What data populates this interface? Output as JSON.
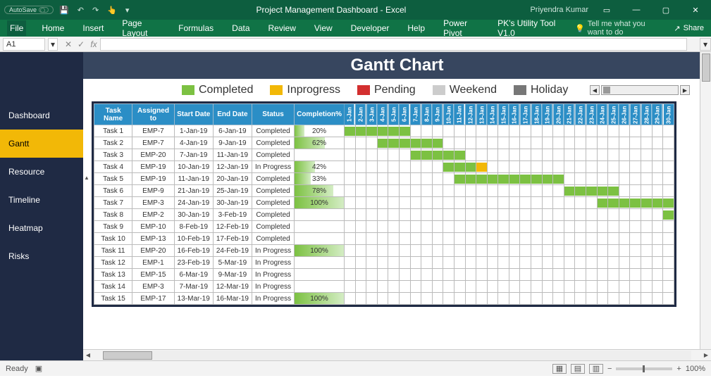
{
  "titlebar": {
    "autosave": "AutoSave",
    "doc_title": "Project Management Dashboard  -  Excel",
    "user": "Priyendra Kumar"
  },
  "qat": {
    "save": "save",
    "undo": "undo",
    "redo": "redo",
    "touch": "touch",
    "more": "more"
  },
  "ribbon": {
    "tabs": [
      "File",
      "Home",
      "Insert",
      "Page Layout",
      "Formulas",
      "Data",
      "Review",
      "View",
      "Developer",
      "Help",
      "Power Pivot",
      "PK's Utility Tool V1.0"
    ],
    "tell": "Tell me what you want to do",
    "share": "Share"
  },
  "formula": {
    "name": "A1",
    "fx": "fx"
  },
  "sidebar": {
    "items": [
      "Dashboard",
      "Gantt",
      "Resource",
      "Timeline",
      "Heatmap",
      "Risks"
    ],
    "active": 1
  },
  "banner": "Gantt Chart",
  "legend": {
    "completed": "Completed",
    "inprogress": "Inprogress",
    "pending": "Pending",
    "weekend": "Weekend",
    "holiday": "Holiday"
  },
  "headers": {
    "task": "Task Name",
    "assigned": "Assigned to",
    "start": "Start Date",
    "end": "End Date",
    "status": "Status",
    "completion": "Completion%"
  },
  "days": [
    "1-Jan",
    "2-Jan",
    "3-Jan",
    "4-Jan",
    "5-Jan",
    "6-Jan",
    "7-Jan",
    "8-Jan",
    "9-Jan",
    "10-Jan",
    "11-Jan",
    "12-Jan",
    "13-Jan",
    "14-Jan",
    "15-Jan",
    "16-Jan",
    "17-Jan",
    "18-Jan",
    "19-Jan",
    "20-Jan",
    "21-Jan",
    "22-Jan",
    "23-Jan",
    "24-Jan",
    "25-Jan",
    "26-Jan",
    "27-Jan",
    "28-Jan",
    "29-Jan",
    "30-Jan"
  ],
  "weekend_idx": [
    4,
    5,
    11,
    12,
    18,
    19,
    25,
    26
  ],
  "holiday_idx": [
    9
  ],
  "tasks": [
    {
      "name": "Task 1",
      "emp": "EMP-7",
      "start": "1-Jan-19",
      "end": "6-Jan-19",
      "status": "Completed",
      "comp": "20%",
      "bar": [
        0,
        5,
        "g"
      ]
    },
    {
      "name": "Task 2",
      "emp": "EMP-7",
      "start": "4-Jan-19",
      "end": "9-Jan-19",
      "status": "Completed",
      "comp": "62%",
      "bar": [
        3,
        8,
        "g"
      ]
    },
    {
      "name": "Task 3",
      "emp": "EMP-20",
      "start": "7-Jan-19",
      "end": "11-Jan-19",
      "status": "Completed",
      "comp": "",
      "bar": [
        6,
        10,
        "g"
      ]
    },
    {
      "name": "Task 4",
      "emp": "EMP-19",
      "start": "10-Jan-19",
      "end": "12-Jan-19",
      "status": "In Progress",
      "comp": "42%",
      "bar": [
        9,
        11,
        "g"
      ],
      "bar2": [
        12,
        12,
        "y"
      ]
    },
    {
      "name": "Task 5",
      "emp": "EMP-19",
      "start": "11-Jan-19",
      "end": "20-Jan-19",
      "status": "Completed",
      "comp": "33%",
      "bar": [
        10,
        19,
        "g"
      ]
    },
    {
      "name": "Task 6",
      "emp": "EMP-9",
      "start": "21-Jan-19",
      "end": "25-Jan-19",
      "status": "Completed",
      "comp": "78%",
      "bar": [
        20,
        24,
        "g"
      ]
    },
    {
      "name": "Task 7",
      "emp": "EMP-3",
      "start": "24-Jan-19",
      "end": "30-Jan-19",
      "status": "Completed",
      "comp": "100%",
      "bar": [
        23,
        29,
        "g"
      ]
    },
    {
      "name": "Task 8",
      "emp": "EMP-2",
      "start": "30-Jan-19",
      "end": "3-Feb-19",
      "status": "Completed",
      "comp": "",
      "bar": [
        29,
        29,
        "g"
      ]
    },
    {
      "name": "Task 9",
      "emp": "EMP-10",
      "start": "8-Feb-19",
      "end": "12-Feb-19",
      "status": "Completed",
      "comp": ""
    },
    {
      "name": "Task 10",
      "emp": "EMP-13",
      "start": "10-Feb-19",
      "end": "17-Feb-19",
      "status": "Completed",
      "comp": ""
    },
    {
      "name": "Task 11",
      "emp": "EMP-20",
      "start": "16-Feb-19",
      "end": "24-Feb-19",
      "status": "In Progress",
      "comp": "100%"
    },
    {
      "name": "Task 12",
      "emp": "EMP-1",
      "start": "23-Feb-19",
      "end": "5-Mar-19",
      "status": "In Progress",
      "comp": ""
    },
    {
      "name": "Task 13",
      "emp": "EMP-15",
      "start": "6-Mar-19",
      "end": "9-Mar-19",
      "status": "In Progress",
      "comp": ""
    },
    {
      "name": "Task 14",
      "emp": "EMP-3",
      "start": "7-Mar-19",
      "end": "12-Mar-19",
      "status": "In Progress",
      "comp": ""
    },
    {
      "name": "Task 15",
      "emp": "EMP-17",
      "start": "13-Mar-19",
      "end": "16-Mar-19",
      "status": "In Progress",
      "comp": "100%"
    }
  ],
  "statusbar": {
    "ready": "Ready",
    "zoom": "100%"
  },
  "chart_data": {
    "type": "gantt",
    "title": "Gantt Chart",
    "x_range": [
      "1-Jan",
      "30-Jan"
    ],
    "columns": [
      "Task Name",
      "Assigned to",
      "Start Date",
      "End Date",
      "Status",
      "Completion%"
    ],
    "legend": [
      "Completed",
      "Inprogress",
      "Pending",
      "Weekend",
      "Holiday"
    ],
    "rows": [
      {
        "task": "Task 1",
        "assigned": "EMP-7",
        "start": "1-Jan-19",
        "end": "6-Jan-19",
        "status": "Completed",
        "completion_pct": 20
      },
      {
        "task": "Task 2",
        "assigned": "EMP-7",
        "start": "4-Jan-19",
        "end": "9-Jan-19",
        "status": "Completed",
        "completion_pct": 62
      },
      {
        "task": "Task 3",
        "assigned": "EMP-20",
        "start": "7-Jan-19",
        "end": "11-Jan-19",
        "status": "Completed",
        "completion_pct": null
      },
      {
        "task": "Task 4",
        "assigned": "EMP-19",
        "start": "10-Jan-19",
        "end": "12-Jan-19",
        "status": "In Progress",
        "completion_pct": 42
      },
      {
        "task": "Task 5",
        "assigned": "EMP-19",
        "start": "11-Jan-19",
        "end": "20-Jan-19",
        "status": "Completed",
        "completion_pct": 33
      },
      {
        "task": "Task 6",
        "assigned": "EMP-9",
        "start": "21-Jan-19",
        "end": "25-Jan-19",
        "status": "Completed",
        "completion_pct": 78
      },
      {
        "task": "Task 7",
        "assigned": "EMP-3",
        "start": "24-Jan-19",
        "end": "30-Jan-19",
        "status": "Completed",
        "completion_pct": 100
      },
      {
        "task": "Task 8",
        "assigned": "EMP-2",
        "start": "30-Jan-19",
        "end": "3-Feb-19",
        "status": "Completed",
        "completion_pct": null
      },
      {
        "task": "Task 9",
        "assigned": "EMP-10",
        "start": "8-Feb-19",
        "end": "12-Feb-19",
        "status": "Completed",
        "completion_pct": null
      },
      {
        "task": "Task 10",
        "assigned": "EMP-13",
        "start": "10-Feb-19",
        "end": "17-Feb-19",
        "status": "Completed",
        "completion_pct": null
      },
      {
        "task": "Task 11",
        "assigned": "EMP-20",
        "start": "16-Feb-19",
        "end": "24-Feb-19",
        "status": "In Progress",
        "completion_pct": 100
      },
      {
        "task": "Task 12",
        "assigned": "EMP-1",
        "start": "23-Feb-19",
        "end": "5-Mar-19",
        "status": "In Progress",
        "completion_pct": null
      },
      {
        "task": "Task 13",
        "assigned": "EMP-15",
        "start": "6-Mar-19",
        "end": "9-Mar-19",
        "status": "In Progress",
        "completion_pct": null
      },
      {
        "task": "Task 14",
        "assigned": "EMP-3",
        "start": "7-Mar-19",
        "end": "12-Mar-19",
        "status": "In Progress",
        "completion_pct": null
      },
      {
        "task": "Task 15",
        "assigned": "EMP-17",
        "start": "13-Mar-19",
        "end": "16-Mar-19",
        "status": "In Progress",
        "completion_pct": 100
      }
    ]
  }
}
